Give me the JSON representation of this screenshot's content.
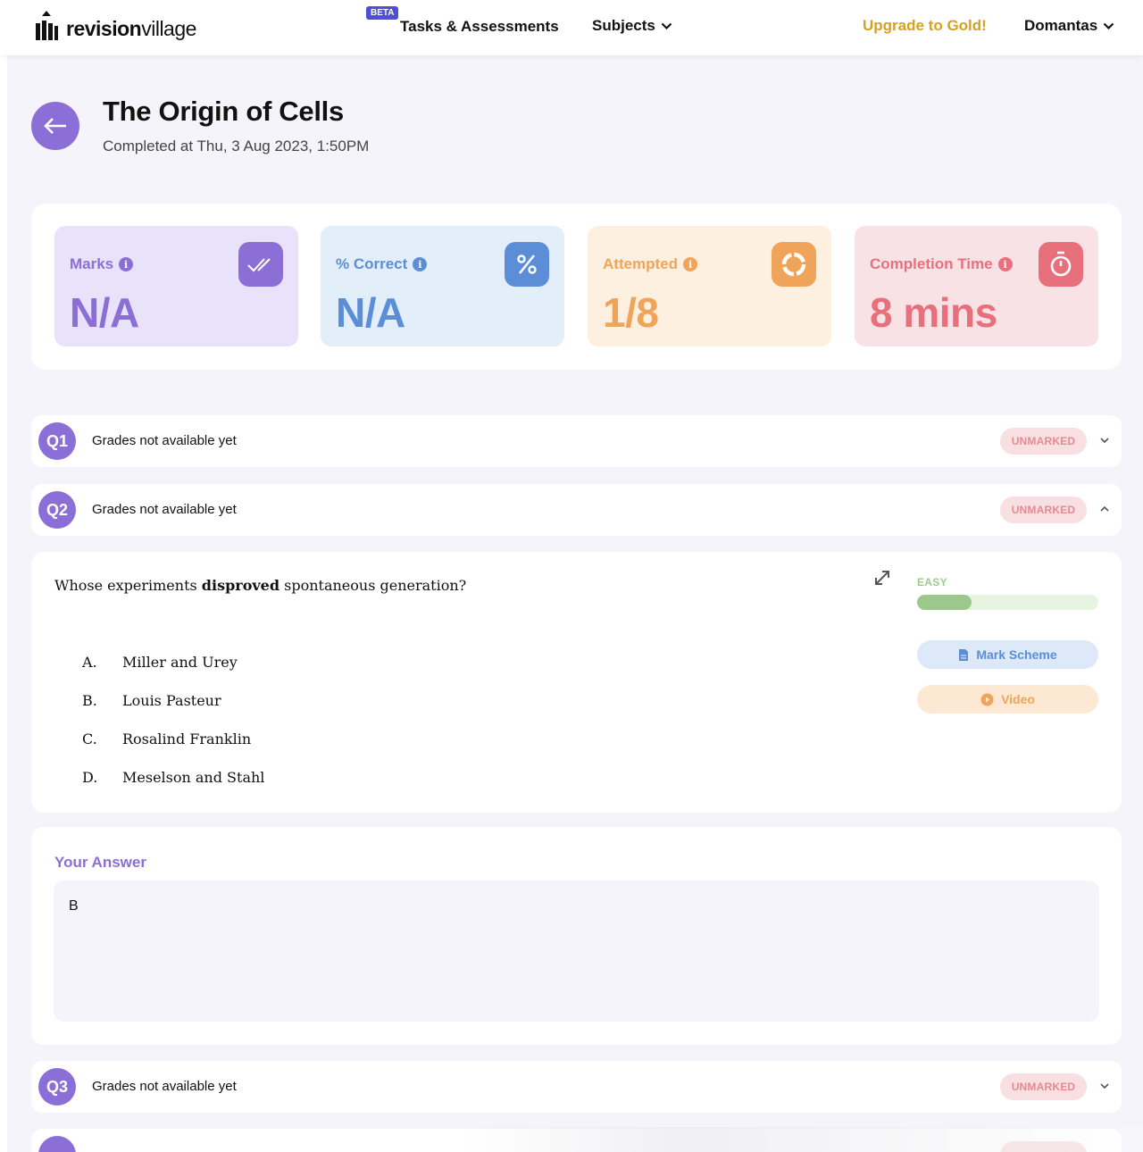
{
  "nav": {
    "logo_bold": "revision",
    "logo_light": "village",
    "beta": "BETA",
    "tasks": "Tasks & Assessments",
    "subjects": "Subjects",
    "upgrade": "Upgrade to Gold!",
    "user": "Domantas"
  },
  "header": {
    "title": "The Origin of Cells",
    "subtitle": "Completed at Thu, 3 Aug 2023, 1:50PM"
  },
  "stats": [
    {
      "label": "Marks",
      "value": "N/A",
      "icon": "double-check-icon",
      "color": "#8b6fd6",
      "bg": "#e8e3fa"
    },
    {
      "label": "% Correct",
      "value": "N/A",
      "icon": "percent-icon",
      "color": "#5b8ed6",
      "bg": "#e3eefb"
    },
    {
      "label": "Attempted",
      "value": "1/8",
      "icon": "progress-ring-icon",
      "color": "#f0a45a",
      "bg": "#fdf0e0"
    },
    {
      "label": "Completion Time",
      "value": "8 mins",
      "icon": "stopwatch-icon",
      "color": "#e8707d",
      "bg": "#f8e2e5"
    }
  ],
  "questions": [
    {
      "id": "Q1",
      "text": "Grades not available yet",
      "status": "UNMARKED",
      "expanded": false
    },
    {
      "id": "Q2",
      "text": "Grades not available yet",
      "status": "UNMARKED",
      "expanded": true
    },
    {
      "id": "Q3",
      "text": "Grades not available yet",
      "status": "UNMARKED",
      "expanded": false
    }
  ],
  "q2_detail": {
    "prompt_pre": "Whose experiments ",
    "prompt_bold": "disproved",
    "prompt_post": " spontaneous generation?",
    "options": [
      {
        "letter": "A.",
        "text": "Miller and Urey"
      },
      {
        "letter": "B.",
        "text": "Louis Pasteur"
      },
      {
        "letter": "C.",
        "text": "Rosalind Franklin"
      },
      {
        "letter": "D.",
        "text": "Meselson and Stahl"
      }
    ],
    "difficulty": "EASY",
    "difficulty_level": 0.3,
    "mark_scheme": "Mark Scheme",
    "video": "Video"
  },
  "answer": {
    "title": "Your Answer",
    "value": "B"
  }
}
